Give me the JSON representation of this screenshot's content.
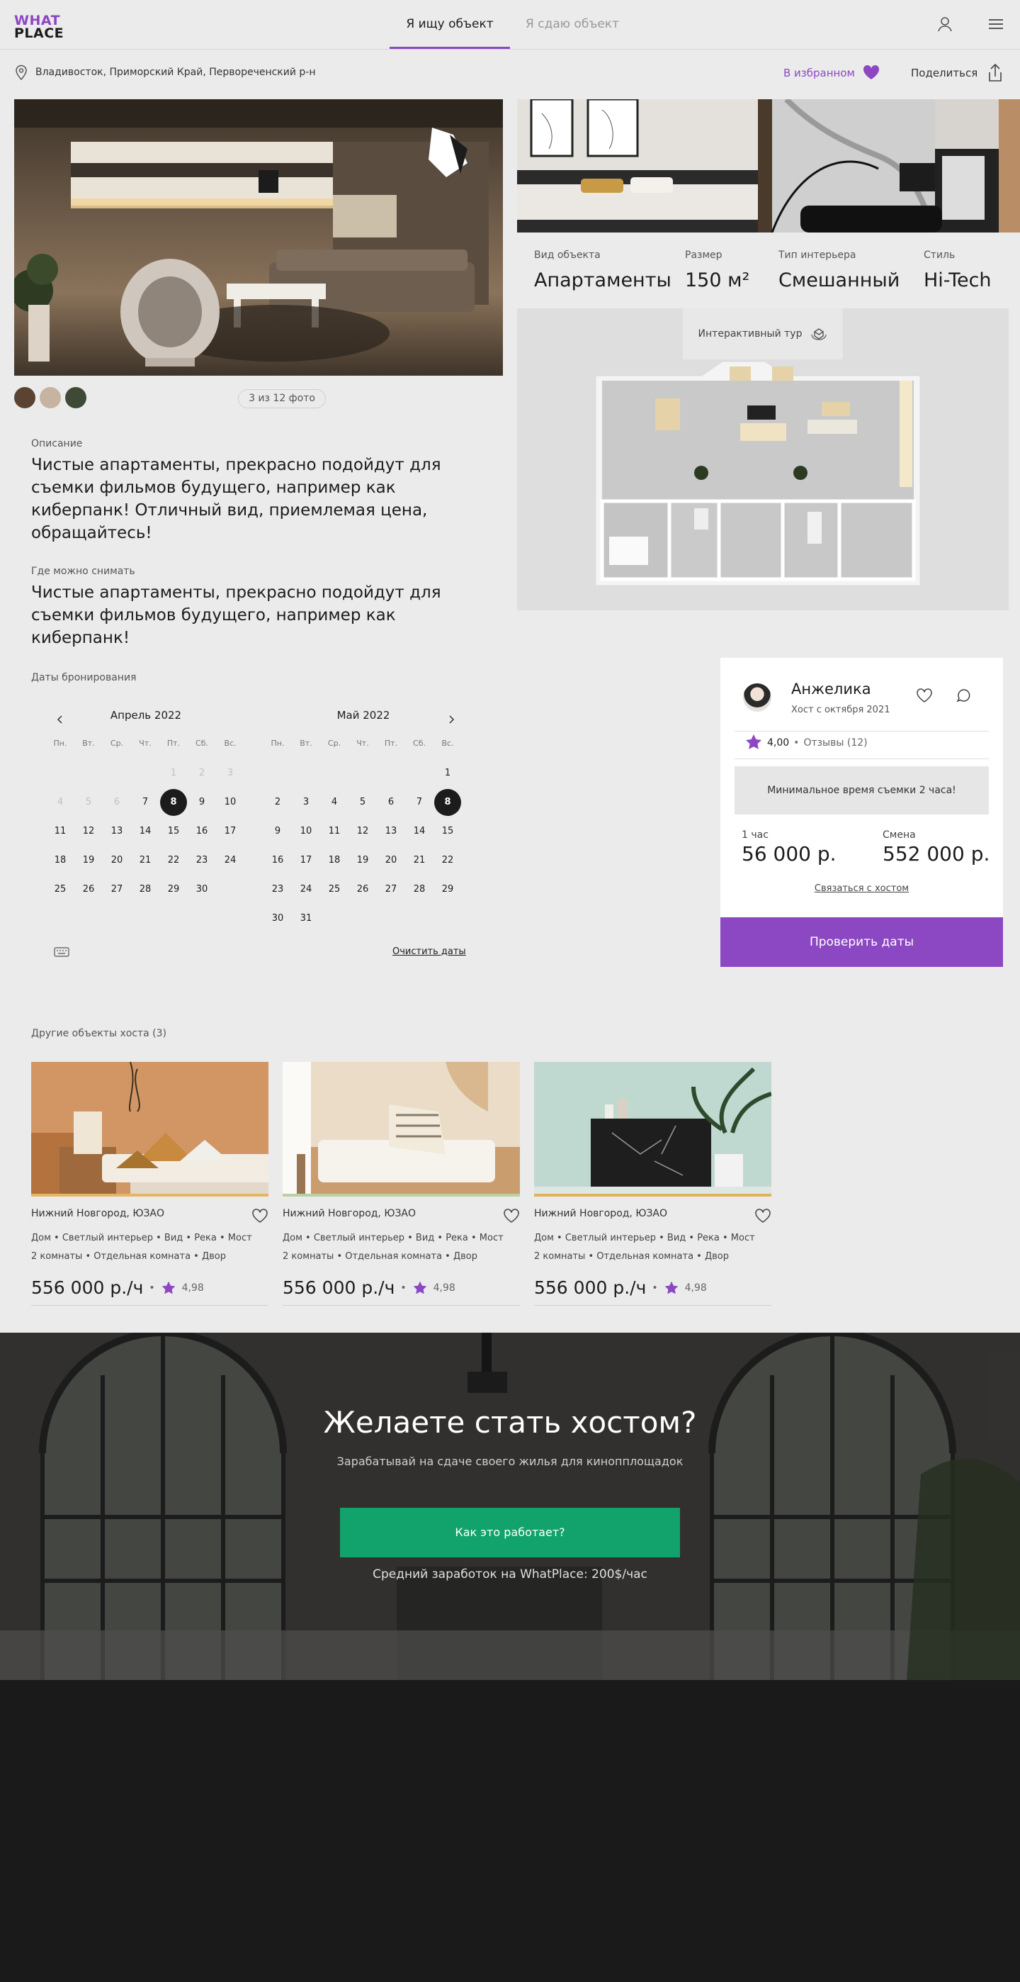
{
  "header": {
    "logo_line1": "WHAT",
    "logo_line2": "PLACE",
    "tab_active": "Я ищу объект",
    "tab_inactive": "Я сдаю объект",
    "user_icon": "user-icon",
    "menu_icon": "menu-icon"
  },
  "location": {
    "text": "Владивосток, Приморский Край, Первореченский р-н",
    "favorite_label": "В избранном",
    "share_label": "Поделиться"
  },
  "gallery": {
    "counter": "3 из 12 фото",
    "swatches": [
      "#5a4332",
      "#c6b3a0",
      "#3f4a36"
    ]
  },
  "specs": [
    {
      "key": "Вид объекта",
      "value": "Апартаменты"
    },
    {
      "key": "Размер",
      "value": "150 м²"
    },
    {
      "key": "Тип интерьера",
      "value": "Смешанный"
    },
    {
      "key": "Стиль",
      "value": "Hi-Tech"
    }
  ],
  "tour": {
    "label": "Интерактивный тур"
  },
  "description": {
    "label": "Описание",
    "text": "Чистые апартаменты, прекрасно подойдут для съемки фильмов будущего, например как киберпанк! Отличный вид, приемлемая цена, обращайтесь!"
  },
  "where": {
    "label": "Где можно снимать",
    "text": "Чистые апартаменты, прекрасно подойдут для съемки фильмов будущего, например как киберпанк!"
  },
  "calendar": {
    "label": "Даты бронирования",
    "weekdays": [
      "Пн.",
      "Вт.",
      "Ср.",
      "Чт.",
      "Пт.",
      "Сб.",
      "Вс."
    ],
    "months": [
      {
        "title": "Апрель 2022",
        "weeks": [
          [
            "",
            "",
            "",
            "",
            "1",
            "2",
            "3"
          ],
          [
            "4",
            "5",
            "6",
            "7",
            "8",
            "9",
            "10"
          ],
          [
            "11",
            "12",
            "13",
            "14",
            "15",
            "16",
            "17"
          ],
          [
            "18",
            "19",
            "20",
            "21",
            "22",
            "23",
            "24"
          ],
          [
            "25",
            "26",
            "27",
            "28",
            "29",
            "30",
            ""
          ]
        ],
        "dimmed": [
          "1",
          "2",
          "3",
          "4",
          "5",
          "6"
        ],
        "selected": "8"
      },
      {
        "title": "Май 2022",
        "weeks": [
          [
            "",
            "",
            "",
            "",
            "",
            "",
            "1"
          ],
          [
            "2",
            "3",
            "4",
            "5",
            "6",
            "7",
            "8"
          ],
          [
            "9",
            "10",
            "11",
            "12",
            "13",
            "14",
            "15"
          ],
          [
            "16",
            "17",
            "18",
            "19",
            "20",
            "21",
            "22"
          ],
          [
            "23",
            "24",
            "25",
            "26",
            "27",
            "28",
            "29"
          ],
          [
            "30",
            "31",
            "",
            "",
            "",
            "",
            ""
          ]
        ],
        "dimmed": [],
        "selected": "8"
      }
    ],
    "clear_label": "Очистить даты"
  },
  "host": {
    "name": "Анжелика",
    "since": "Хост с октября 2021",
    "rating": "4,00",
    "reviews": "Отзывы (12)",
    "notice": "Минимальное время съемки 2 часа!",
    "price_hour_label": "1 час",
    "price_hour": "56 000 р.",
    "price_shift_label": "Смена",
    "price_shift": "552 000 р.",
    "contact_label": "Связаться с хостом",
    "check_label": "Проверить даты"
  },
  "other": {
    "title": "Другие объекты хоста (3)",
    "cards": [
      {
        "city": "Нижний Новгород, ЮЗАО",
        "tags1": "Дом • Светлый интерьер • Вид • Река • Мост",
        "tags2": "2 комнаты • Отдельная комната • Двор",
        "price": "556 000 р./ч",
        "rating": "4,98"
      },
      {
        "city": "Нижний Новгород, ЮЗАО",
        "tags1": "Дом • Светлый интерьер • Вид • Река • Мост",
        "tags2": "2 комнаты • Отдельная комната • Двор",
        "price": "556 000 р./ч",
        "rating": "4,98"
      },
      {
        "city": "Нижний Новгород, ЮЗАО",
        "tags1": "Дом • Светлый интерьер • Вид • Река • Мост",
        "tags2": "2 комнаты • Отдельная комната • Двор",
        "price": "556 000 р./ч",
        "rating": "4,98"
      }
    ]
  },
  "cta": {
    "title": "Желаете стать хостом?",
    "subtitle": "Зарабатывай на сдаче своего жилья для кинопплощадок",
    "button": "Как это работает?",
    "earning": "Средний заработок на WhatPlace: 200$/час"
  },
  "colors": {
    "accent": "#8c47c3",
    "green": "#11a36b",
    "dark": "#1a1a1a"
  }
}
